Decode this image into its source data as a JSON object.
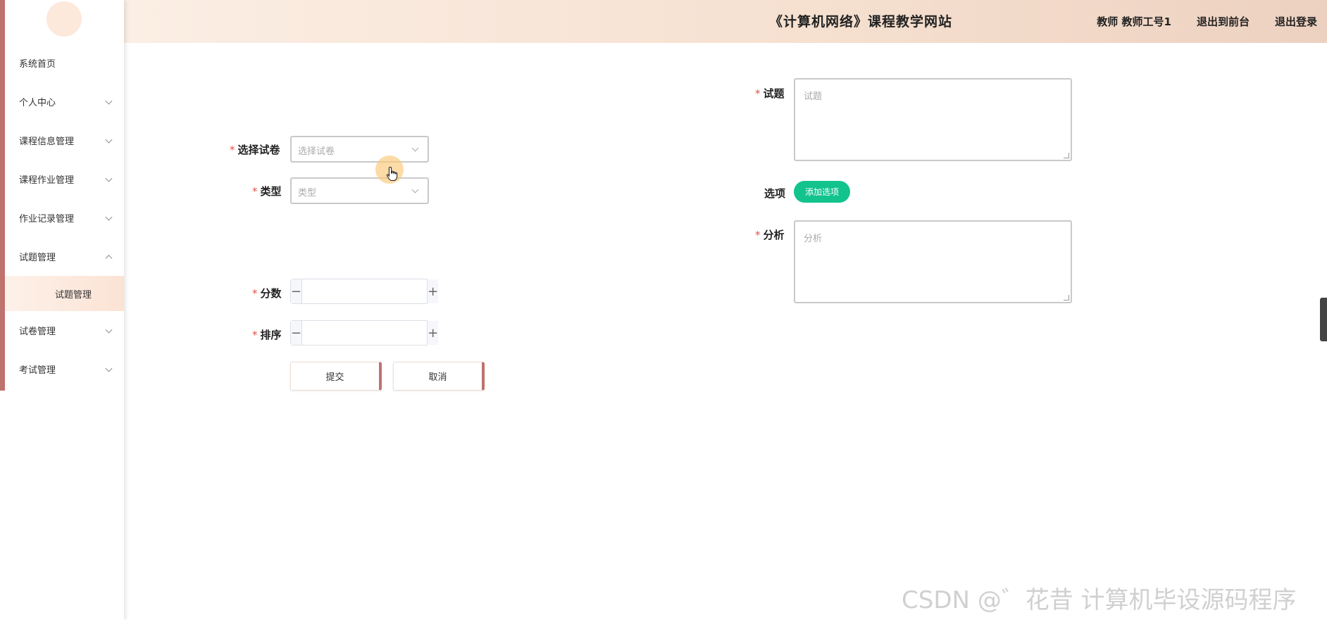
{
  "header": {
    "site_title": "《计算机网络》课程教学网站",
    "user_label": "教师 教师工号1",
    "back_front_label": "退出到前台",
    "logout_label": "退出登录"
  },
  "sidebar": {
    "items": [
      {
        "label": "系统首页"
      },
      {
        "label": "个人中心"
      },
      {
        "label": "课程信息管理"
      },
      {
        "label": "课程作业管理"
      },
      {
        "label": "作业记录管理"
      },
      {
        "label": "试题管理"
      },
      {
        "label": "试卷管理"
      },
      {
        "label": "考试管理"
      }
    ],
    "active_submenu": {
      "label": "试题管理"
    }
  },
  "form": {
    "paper": {
      "label": "选择试卷",
      "placeholder": "选择试卷"
    },
    "type": {
      "label": "类型",
      "placeholder": "类型"
    },
    "score": {
      "label": "分数",
      "value": ""
    },
    "order": {
      "label": "排序",
      "value": ""
    },
    "question": {
      "label": "试题",
      "placeholder": "试题"
    },
    "options": {
      "label": "选项",
      "add_label": "添加选项"
    },
    "analysis": {
      "label": "分析",
      "placeholder": "分析"
    },
    "submit_label": "提交",
    "cancel_label": "取消",
    "stepper_minus": "−",
    "stepper_plus": "+"
  },
  "watermark": "CSDN @゛花昔 计算机毕设源码程序",
  "colors": {
    "accent": "#c0726e",
    "add_button": "#12c38d",
    "required": "#e0524c"
  }
}
